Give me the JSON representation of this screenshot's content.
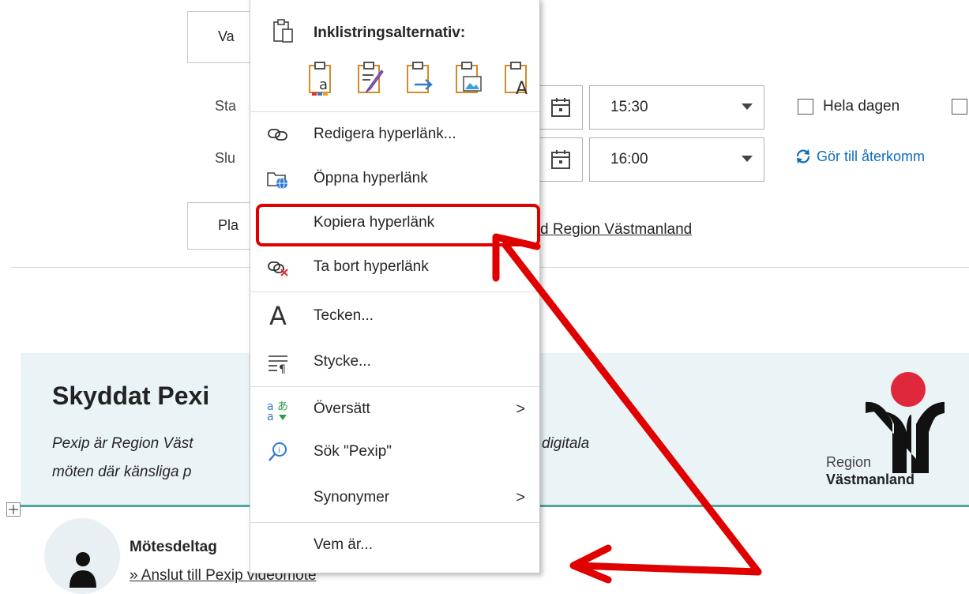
{
  "form": {
    "top_button_label": "Va",
    "start_label": "Sta",
    "end_label": "Slu",
    "location_button_label": "Pla",
    "start_time": "15:30",
    "end_time": "16:00",
    "all_day_label": "Hela dagen",
    "recurring_label": "Gör till återkomm",
    "location_link": "d Region Västmanland"
  },
  "banner": {
    "title": "Skyddat Pexi",
    "desc_line1": "Pexip är Region Väst",
    "desc_line1b": "digitala",
    "desc_line2": "möten där känsliga p",
    "logo_line1": "Region",
    "logo_line2": "Västmanland",
    "logo_color": "#e0283c"
  },
  "participant": {
    "heading": "Mötesdeltag",
    "join_link": "» Anslut till Pexip videomöte"
  },
  "context_menu": {
    "paste_header": "Inklistringsalternativ:",
    "items": {
      "edit_hyperlink": "Redigera hyperlänk...",
      "open_hyperlink": "Öppna hyperlänk",
      "copy_hyperlink": "Kopiera hyperlänk",
      "remove_hyperlink": "Ta bort hyperlänk",
      "font": "Tecken...",
      "paragraph": "Stycke...",
      "translate": "Översätt",
      "search": "Sök \"Pexip\"",
      "synonyms": "Synonymer",
      "who_is": "Vem är..."
    },
    "submenu_arrow": ">",
    "font_glyph": "A"
  },
  "colors": {
    "annotation_red": "#e00000",
    "banner_bg": "#eaf3f6",
    "banner_line": "#4aa8a0",
    "link_blue": "#0f6cbd"
  }
}
